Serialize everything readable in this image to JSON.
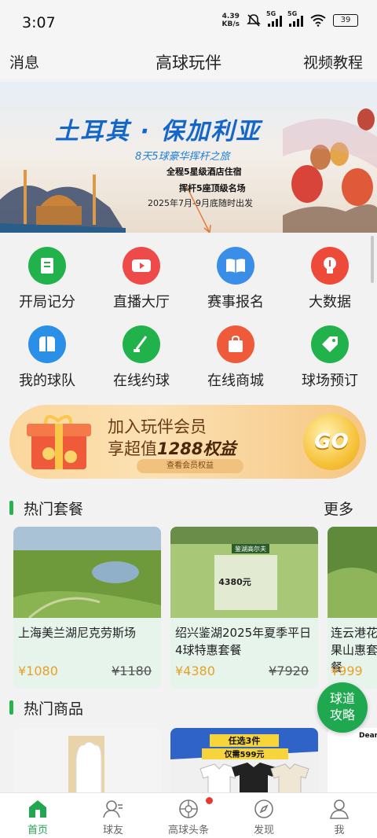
{
  "status_bar": {
    "time": "3:07",
    "speed_value": "4.39",
    "speed_unit": "KB/s",
    "sim1": "5G",
    "sim2": "5G",
    "battery": "39"
  },
  "header": {
    "left_link": "消息",
    "title": "高球玩伴",
    "right_link": "视频教程"
  },
  "banner": {
    "title": "土耳其 · 保加利亚",
    "subtitle": "8天5球豪华挥杆之旅",
    "line1": "全程5星级酒店住宿",
    "line2": "挥杆5座顶级名场",
    "line3": "2025年7月-9月底随时出发"
  },
  "menu": [
    {
      "label": "开局记分",
      "icon": "scorecard-icon",
      "color": "#22b24c"
    },
    {
      "label": "直播大厅",
      "icon": "video-icon",
      "color": "#ee4a4a"
    },
    {
      "label": "赛事报名",
      "icon": "book-icon",
      "color": "#3a8ee8"
    },
    {
      "label": "大数据",
      "icon": "lightbulb-icon",
      "color": "#ee4a3a"
    },
    {
      "label": "我的球队",
      "icon": "team-icon",
      "color": "#2a8fe6"
    },
    {
      "label": "在线约球",
      "icon": "golf-club-icon",
      "color": "#22b24c"
    },
    {
      "label": "在线商城",
      "icon": "shopping-bag-icon",
      "color": "#ee5a3a"
    },
    {
      "label": "球场预订",
      "icon": "tag-icon",
      "color": "#22b24c"
    }
  ],
  "member": {
    "line1": "加入玩伴会员",
    "line2_prefix": "享超值",
    "line2_bold": "1288权益",
    "link": "查看会员权益",
    "go": "GO"
  },
  "hot_packages": {
    "title": "热门套餐",
    "more": "更多",
    "items": [
      {
        "name": "上海美兰湖尼克劳斯场",
        "price": "¥1080",
        "original": "¥1180"
      },
      {
        "name": "绍兴鉴湖2025年夏季平日4球特惠套餐",
        "price": "¥4380",
        "original": "¥7920",
        "image_price": "4380元",
        "image_title": "鉴湖高尔夫"
      },
      {
        "name": "连云港花果山惠套餐",
        "price": "¥999",
        "original": ""
      }
    ]
  },
  "hot_goods": {
    "title": "热门商品",
    "promo_line1": "任选3件",
    "promo_line2": "仅需599元",
    "brand": "Dear"
  },
  "float_button": {
    "line1": "球道",
    "line2": "攻略"
  },
  "tabs": [
    {
      "label": "首页",
      "icon": "home-icon",
      "active": true
    },
    {
      "label": "球友",
      "icon": "friends-icon",
      "active": false
    },
    {
      "label": "高球头条",
      "icon": "headlines-icon",
      "active": false
    },
    {
      "label": "发现",
      "icon": "compass-icon",
      "active": false
    },
    {
      "label": "我",
      "icon": "user-icon",
      "active": false
    }
  ]
}
